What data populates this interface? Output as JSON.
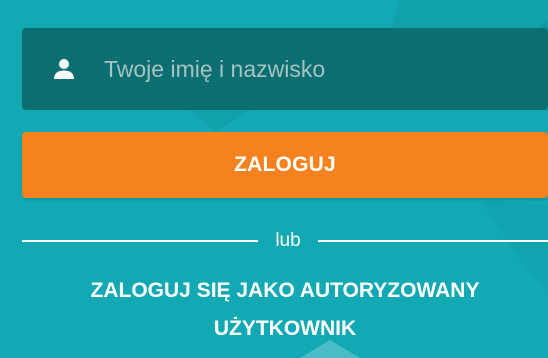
{
  "login_form": {
    "name_field": {
      "placeholder": "Twoje imię i nazwisko",
      "value": "",
      "icon": "user-icon"
    },
    "login_button_label": "ZALOGUJ",
    "divider_text": "lub",
    "sso_link_label": "ZALOGUJ SIĘ JAKO AUTORYZOWANY UŻYTKOWNIK"
  },
  "colors": {
    "background": "#12a9b5",
    "input_background": "#0b6f71",
    "button": "#f5821f",
    "text": "#ffffff"
  }
}
